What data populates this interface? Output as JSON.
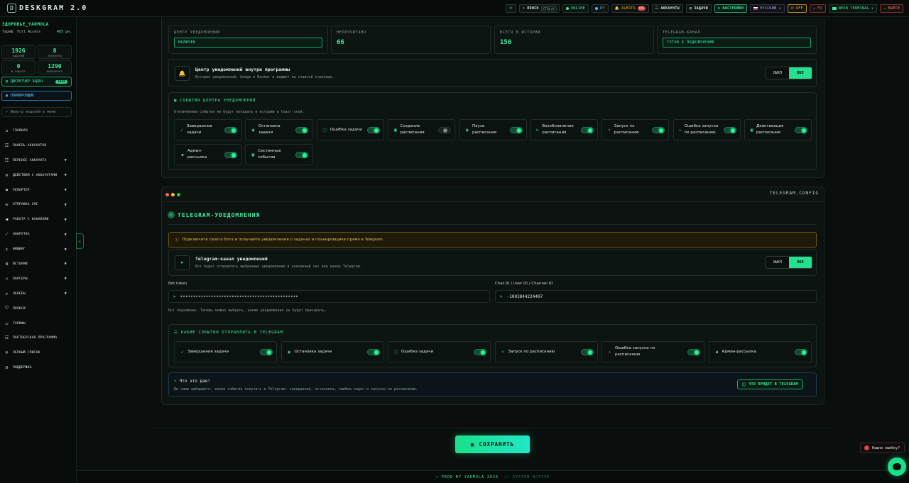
{
  "app": {
    "logo_text": "DESKGRAM 2.0",
    "logo_badge": "D"
  },
  "topbar": {
    "search_label": "ПОИСК",
    "search_kbd": "CTRL+K",
    "online_label": "ONLINE",
    "lang_btn": "DY",
    "alerts_label": "ALERTS",
    "alerts_count": "66",
    "accounts_label": "АККАУНТЫ",
    "tasks_label": "ЗАДАЧИ",
    "settings_label": "НАСТРОЙКИ",
    "language_label": "РУССКИЙ",
    "off_label": "OFF",
    "fx_label": "FX",
    "terminal_label": "NEON TERMINAL",
    "logout_label": "ВЫЙТИ"
  },
  "sidebar": {
    "username": "ЗДОРОВЬЕ_YARMOLA",
    "plan": "Тариф: Full Access",
    "days": "485 дн.",
    "stats": [
      {
        "value": "1926",
        "label": "ЗАДАНИЙ"
      },
      {
        "value": "8",
        "label": "АККАУНТЫ"
      },
      {
        "value": "0",
        "label": "В РАБОТЕ"
      },
      {
        "value": "1290",
        "label": "ВЫПОЛНЕНО"
      }
    ],
    "dispatcher_label": "ДИСПЕТЧЕР ЗАДАЧ",
    "dispatcher_count": "1926",
    "scheduler_label": "ПЛАНИРОВЩИК",
    "filter_placeholder": "Фильтр модулей в меню",
    "menu": [
      {
        "label": "ГЛАВНАЯ",
        "icon": "home-icon",
        "glyph": "⌂",
        "chevron": false
      },
      {
        "label": "ПАНЕЛЬ АККАУНТОВ",
        "icon": "users-icon",
        "glyph": "☷",
        "chevron": false
      },
      {
        "label": "ПЕРЕНОС АККАУНТА",
        "icon": "users-icon",
        "glyph": "☷",
        "chevron": true
      },
      {
        "label": "ДЕЙСТВИЯ С АККАУНТАМИ",
        "icon": "user-icon",
        "glyph": "☺",
        "chevron": true
      },
      {
        "label": "РЕПОРТЕР",
        "icon": "flag-icon",
        "glyph": "⚑",
        "chevron": true
      },
      {
        "label": "ОТПРАВКА СМС",
        "icon": "message-icon",
        "glyph": "✉",
        "chevron": true
      },
      {
        "label": "РАБОТА С КАНАЛАМИ",
        "icon": "megaphone-icon",
        "glyph": "◀",
        "chevron": true
      },
      {
        "label": "НАКРУТКА",
        "icon": "chart-icon",
        "glyph": "⟋",
        "chevron": true
      },
      {
        "label": "ФИШИНГ",
        "icon": "hook-icon",
        "glyph": "⚓",
        "chevron": true
      },
      {
        "label": "ИСТОРИИ",
        "icon": "layers-icon",
        "glyph": "≣",
        "chevron": true
      },
      {
        "label": "ПАРСЕРЫ",
        "icon": "search-icon",
        "glyph": "⌕",
        "chevron": true
      },
      {
        "label": "ЧЕКЕРЫ",
        "icon": "check-circle-icon",
        "glyph": "✔",
        "chevron": true
      },
      {
        "label": "ПРОКСИ",
        "icon": "shield-icon",
        "glyph": "⛉",
        "chevron": false
      },
      {
        "label": "ТАРИФЫ",
        "icon": "card-icon",
        "glyph": "▭",
        "chevron": false
      },
      {
        "label": "ПАРТНЕРСКАЯ ПРОГРАММА",
        "icon": "users-icon",
        "glyph": "☷",
        "chevron": false
      },
      {
        "label": "ЧЕРНЫЙ СПИСОК",
        "icon": "user-block-icon",
        "glyph": "☹",
        "chevron": false
      },
      {
        "label": "ПОДДЕРЖКА",
        "icon": "headset-icon",
        "glyph": "☊",
        "chevron": false
      }
    ]
  },
  "notif_center": {
    "stats": [
      {
        "label": "ЦЕНТР УВЕДОМЛЕНИЙ",
        "pill": "ВКЛЮЧЕН"
      },
      {
        "label": "НЕПРОЧИТАНО",
        "value": "66"
      },
      {
        "label": "ВСЕГО В ИСТОРИИ",
        "value": "150"
      },
      {
        "label": "TELEGRAM-КАНАЛ",
        "pill": "ГОТОВ К ПОДКЛЮЧЕНИЮ"
      }
    ],
    "inapp_title": "Центр уведомлений внутри программы",
    "inapp_desc": "История уведомлений, badge в Navbar и виджет на главной странице.",
    "seg_off": "ВЫКЛ",
    "seg_on": "ВКЛ",
    "events_title": "СОБЫТИЯ ЦЕНТРА УВЕДОМЛЕНИЙ",
    "events_sub": "Отключённые события не будут попадать в историю и toast-слой.",
    "events": [
      {
        "label": "Завершение задачи",
        "on": true,
        "glyph": "✓"
      },
      {
        "label": "Остановка задачи",
        "on": true,
        "glyph": "◉"
      },
      {
        "label": "Ошибка задачи",
        "on": true,
        "glyph": "ⓘ"
      },
      {
        "label": "Создание расписания",
        "on": false,
        "glyph": "▣"
      },
      {
        "label": "Пауза расписания",
        "on": true,
        "glyph": "◉"
      },
      {
        "label": "Возобновление расписания",
        "on": true,
        "glyph": "▷"
      },
      {
        "label": "Запуск по расписанию",
        "on": true,
        "glyph": "⚡"
      },
      {
        "label": "Ошибка запуска по расписанию",
        "on": true,
        "glyph": "⚠"
      },
      {
        "label": "Деактивация расписания",
        "on": true,
        "glyph": "▣"
      },
      {
        "label": "Админ-рассылка",
        "on": true,
        "glyph": "◀"
      },
      {
        "label": "Системные события",
        "on": true,
        "glyph": "▦"
      }
    ]
  },
  "telegram": {
    "window_title": "TELEGRAM.CONFIG",
    "section_title": "TELEGRAM-УВЕДОМЛЕНИЯ",
    "notice": "Подключите своего бота и получайте уведомления о задачах и планировщике прямо в Telegram.",
    "channel_title": "Telegram-канал уведомлений",
    "channel_desc": "Бот будет отправлять выбранные уведомления в указанный чат или канал Telegram.",
    "seg_off": "ВЫКЛ",
    "seg_on": "ВКЛ",
    "bot_token_label": "Bot token",
    "bot_token_value": "••••••••••••••••••••••••••••••••••••••••••••••",
    "chat_id_label": "Chat ID / User ID / Channel ID",
    "chat_id_value": "-1003844224407",
    "connected_text": "Бот подключен. Теперь можно выбрать, какие уведомления он будет присылать.",
    "events_title": "КАКИЕ СОБЫТИЯ ОТПРАВЛЯТЬ В TELEGRAM",
    "events": [
      {
        "label": "Завершение задачи",
        "on": true,
        "glyph": "✓"
      },
      {
        "label": "Остановка задачи",
        "on": true,
        "glyph": "◉"
      },
      {
        "label": "Ошибка задачи",
        "on": true,
        "glyph": "ⓘ"
      },
      {
        "label": "Запуск по расписанию",
        "on": true,
        "glyph": "⚡"
      },
      {
        "label": "Ошибка запуска по расписанию",
        "on": true,
        "glyph": "⚠"
      },
      {
        "label": "Админ-рассылка",
        "on": true,
        "glyph": "◀"
      }
    ],
    "info_title": "Что это дает",
    "info_desc": "Вы сами выбираете, какие события получать в Telegram: завершение, остановка, ошибки задач и запуски по расписанию.",
    "preview_btn": "ЧТО ПРИДЕТ В TELEGRAM"
  },
  "save_label": "СОХРАНИТЬ",
  "footer": {
    "left": "• PROD BY YARMOLA 2026",
    "right": "// SYSTEM ACTIVE"
  },
  "bug_label": "Нашли ошибку?",
  "colors": {
    "accent": "#3df0a0",
    "bg": "#0a0f0d",
    "warning": "#e2c45a"
  }
}
